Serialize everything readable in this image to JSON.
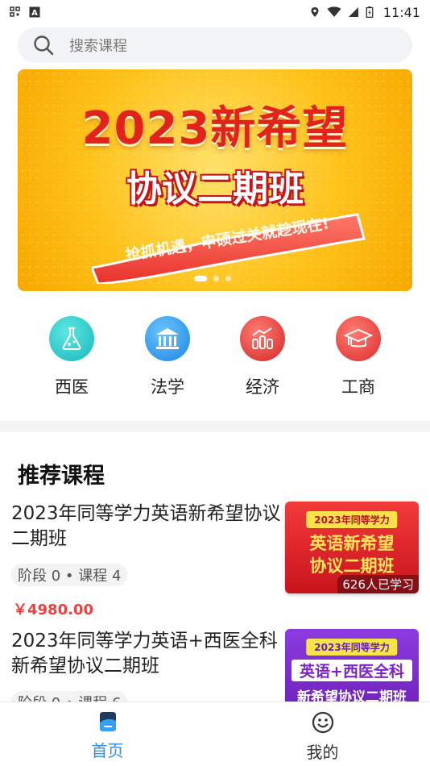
{
  "status_bar": {
    "time": "11:41",
    "left_icons": [
      "grid-icon",
      "a-icon"
    ],
    "right_icons": [
      "location-icon",
      "wifi-icon",
      "signal-icon",
      "battery-icon"
    ]
  },
  "search": {
    "placeholder": "搜索课程",
    "icon": "search-icon"
  },
  "banner": {
    "title": "2023新希望",
    "subtitle": "协议二期班",
    "slogan": "抢抓机遇，申硕过关就趁现在!",
    "slide_count": 3,
    "active_slide": 1
  },
  "categories": [
    {
      "label": "西医",
      "icon": "flask-icon",
      "color": "#23c6c8"
    },
    {
      "label": "法学",
      "icon": "courthouse-icon",
      "color": "#2f9bea"
    },
    {
      "label": "经济",
      "icon": "chart-icon",
      "color": "#e84545"
    },
    {
      "label": "工商",
      "icon": "graduation-cap-icon",
      "color": "#ec4a4a"
    }
  ],
  "section": {
    "title": "推荐课程"
  },
  "courses": [
    {
      "title": "2023年同等学力英语新希望协议二期班",
      "meta": "阶段 0 • 课程 4",
      "price": "￥4980.00",
      "thumb": {
        "tag": "2023年同等学力",
        "line1": "英语新希望",
        "line2": "协议二期班",
        "learners": "626人已学习",
        "bg": "#e5232b"
      }
    },
    {
      "title": "2023年同等学力英语+西医全科新希望协议二期班",
      "meta": "阶段 0 • 课程 6",
      "price": "",
      "thumb": {
        "tag": "2023年同等学力",
        "line1": "英语+西医全科",
        "line2": "新希望协议二期班",
        "learners": "",
        "bg": "#7e2fd0"
      }
    }
  ],
  "tabbar": {
    "tabs": [
      {
        "label": "首页",
        "icon": "home-icon",
        "active": true
      },
      {
        "label": "我的",
        "icon": "smiley-icon",
        "active": false
      }
    ],
    "active_color": "#2d8cf0"
  }
}
